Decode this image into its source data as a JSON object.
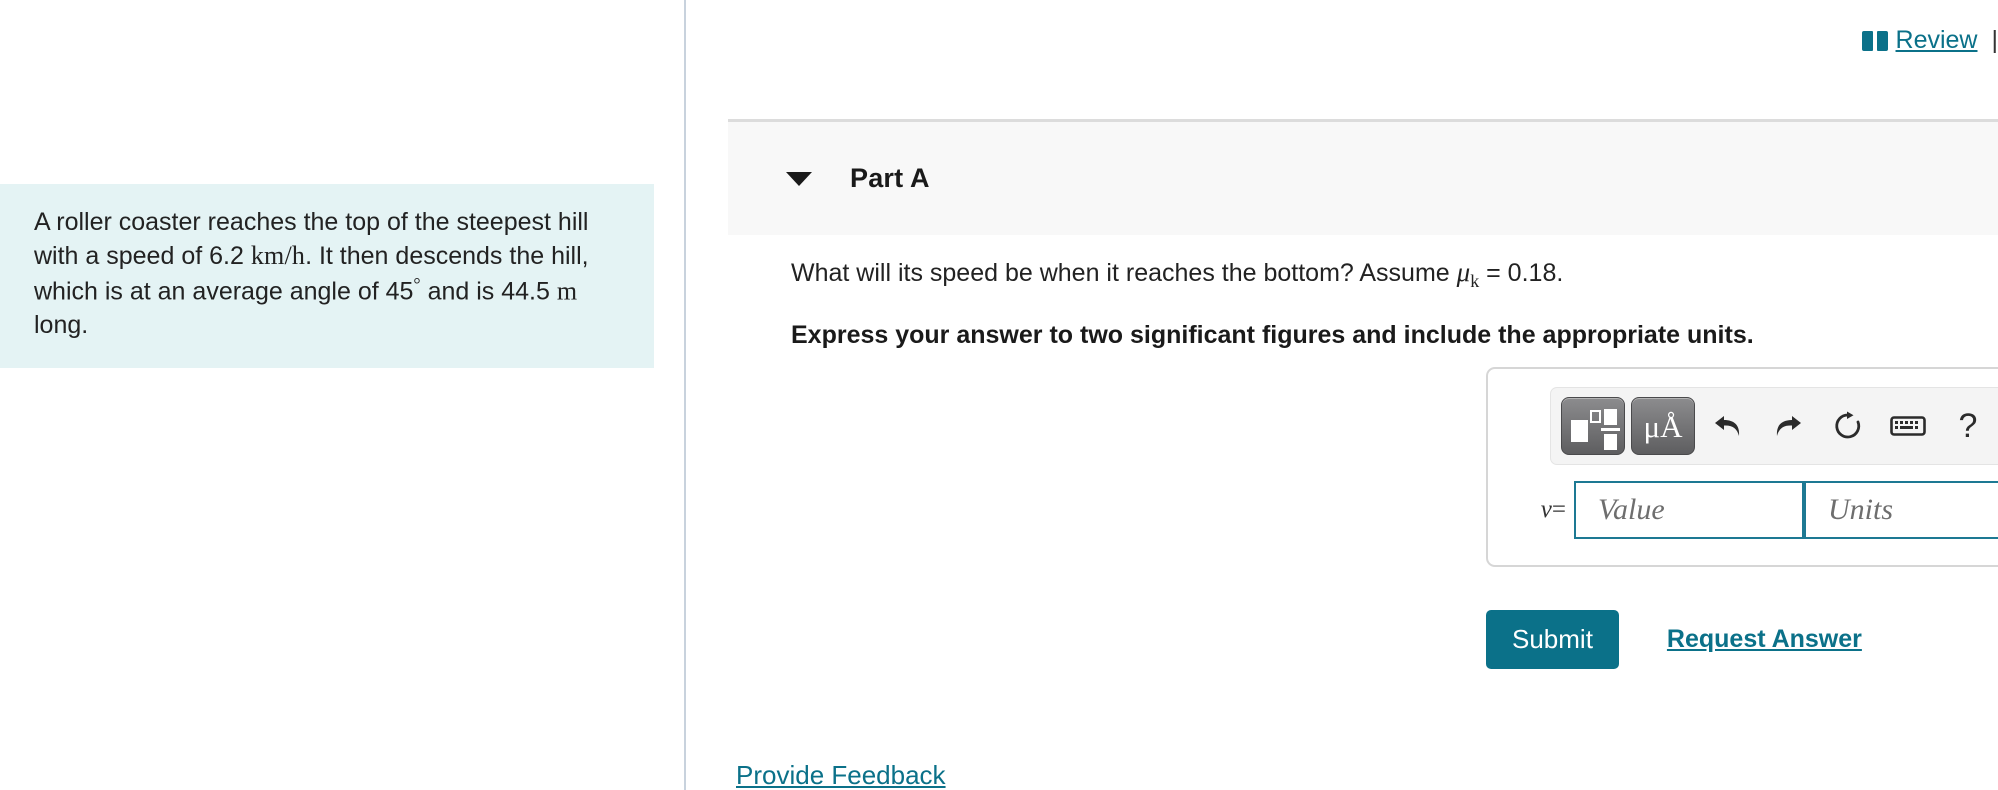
{
  "header": {
    "review_icon": "book-icon",
    "review_label": "Review",
    "separator": "|"
  },
  "left_panel": {
    "problem": {
      "line1_a": "A roller coaster reaches the top of the steepest hill",
      "line2_a": "with a speed of 6.2",
      "unit_speed": "km/h",
      "line2_b": ". It then descends the",
      "line3_a": "hill, which is at an average angle of 45",
      "degree": "°",
      "line3_b": "and is",
      "line4_a": "44.5",
      "unit_length": "m",
      "line4_b": "long."
    }
  },
  "part": {
    "caret_icon": "caret-down-icon",
    "title": "Part A"
  },
  "question": {
    "prompt_a": "What will its speed be when it reaches the bottom? Assume",
    "mu_symbol": "μ",
    "mu_subscript": "k",
    "prompt_b": "= 0.18.",
    "instruction": "Express your answer to two significant figures and include the appropriate units."
  },
  "answer_box": {
    "toolbar": {
      "template_button": "math-template-button",
      "units_button_label": "μÅ",
      "undo_icon": "undo-arrow-icon",
      "redo_icon": "redo-arrow-icon",
      "reset_icon": "reset-circular-arrow-icon",
      "keyboard_icon": "keyboard-icon",
      "help_icon": "?"
    },
    "variable_label": "v",
    "equals_sign": "=",
    "value_placeholder": "Value",
    "value_current": "",
    "units_placeholder": "Units",
    "units_current": ""
  },
  "actions": {
    "submit_label": "Submit",
    "request_answer_label": "Request Answer",
    "provide_feedback_label": "Provide Feedback"
  },
  "colors": {
    "accent_teal": "#0b7189",
    "field_border": "#1d7993",
    "problem_bg": "#e4f3f4",
    "part_band_bg": "#f8f8f8",
    "divider": "#c8d2dd"
  }
}
